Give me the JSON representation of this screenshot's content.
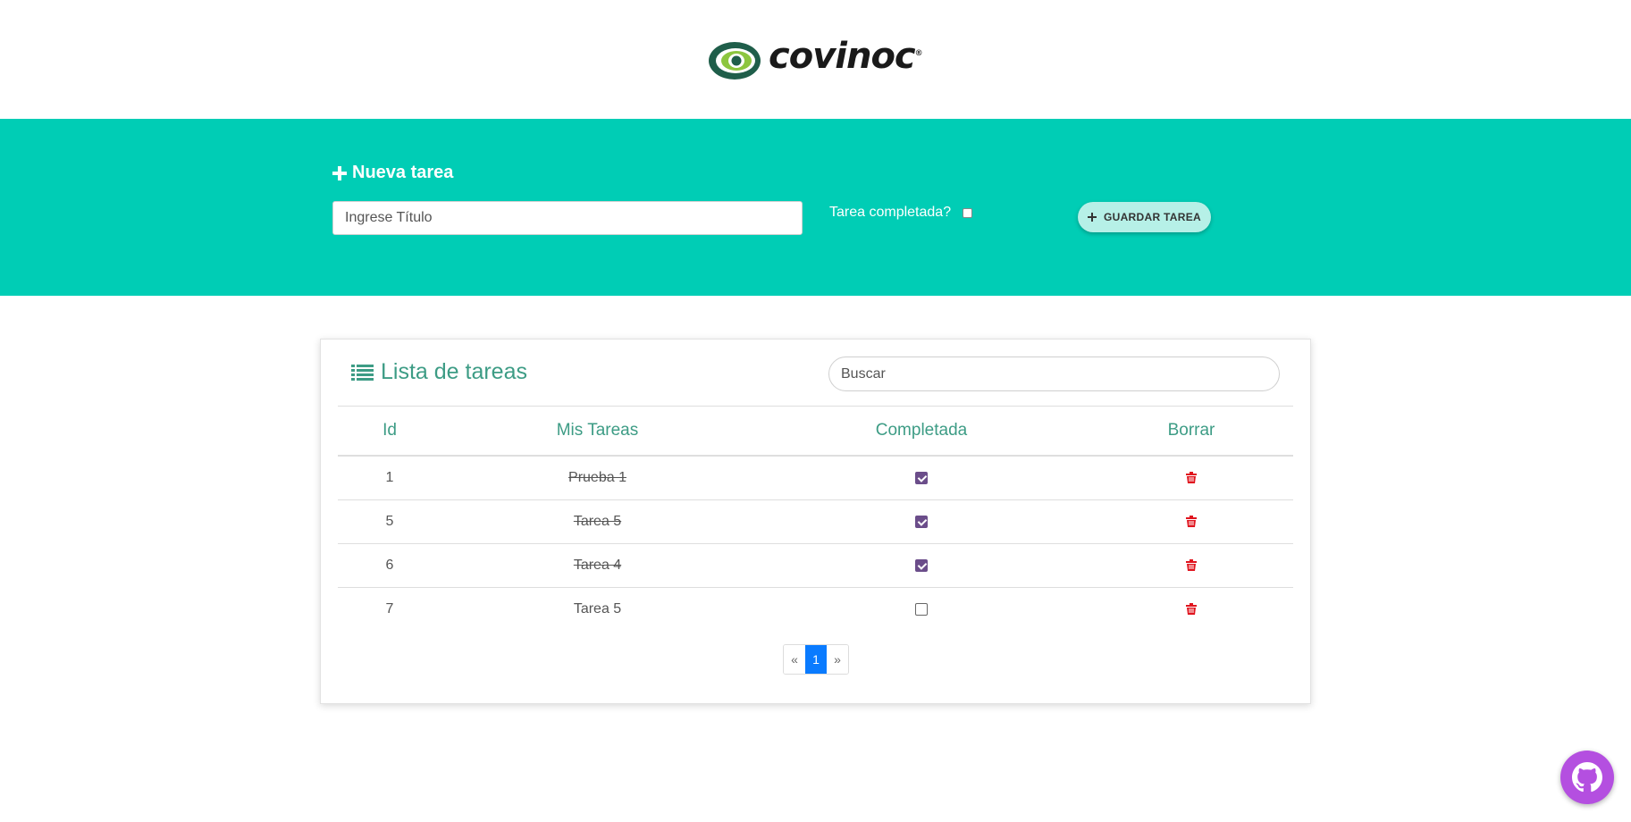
{
  "header": {
    "logo_text": "covinoc",
    "logo_reg": "®"
  },
  "new_task": {
    "title": "Nueva tarea",
    "title_placeholder": "Ingrese Título",
    "completed_label": "Tarea completada?",
    "completed_checked": false,
    "save_label": "GUARDAR TAREA"
  },
  "task_list": {
    "title": "Lista de tareas",
    "search_placeholder": "Buscar",
    "columns": [
      "Id",
      "Mis Tareas",
      "Completada",
      "Borrar"
    ],
    "rows": [
      {
        "id": "1",
        "task": "Prueba 1",
        "completed": true
      },
      {
        "id": "5",
        "task": "Tarea 5",
        "completed": true
      },
      {
        "id": "6",
        "task": "Tarea 4",
        "completed": true
      },
      {
        "id": "7",
        "task": "Tarea 5",
        "completed": false
      }
    ]
  },
  "pagination": {
    "prev": "«",
    "current": "1",
    "next": "»"
  },
  "colors": {
    "teal_band": "#00cdb5",
    "heading_green": "#3d9c85",
    "checkbox_purple": "#6b4d8a",
    "delete_red": "#e0141e",
    "page_active": "#0a7bff",
    "github_fab": "#b44fe0"
  },
  "icons": {
    "new_task": "plus-icon",
    "save": "plus-icon",
    "list": "list-icon",
    "delete": "trash-icon",
    "fab": "github-icon"
  }
}
